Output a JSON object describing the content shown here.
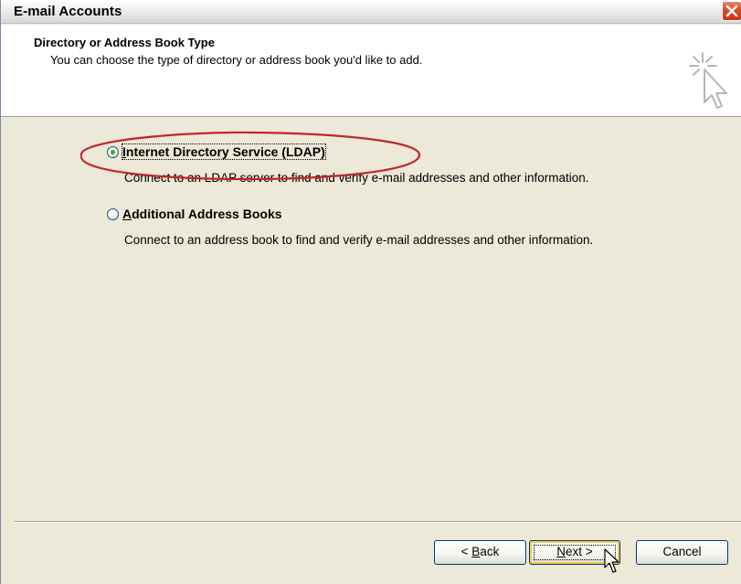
{
  "window": {
    "title": "E-mail Accounts"
  },
  "header": {
    "title": "Directory or Address Book Type",
    "subtitle": "You can choose the type of directory or address book you'd like to add.",
    "icon": "wizard-sparkle-cursor-icon"
  },
  "options": [
    {
      "label_key": "I",
      "label_rest": "nternet Directory Service (LDAP)",
      "description": "Connect to an LDAP server to find and verify e-mail addresses and other information.",
      "selected": true
    },
    {
      "label_key": "A",
      "label_rest": "dditional Address Books",
      "description": "Connect to an address book to find and verify e-mail addresses and other information.",
      "selected": false
    }
  ],
  "buttons": {
    "back_prefix": "< ",
    "back_key": "B",
    "back_rest": "ack",
    "next_key": "N",
    "next_rest": "ext >",
    "cancel": "Cancel"
  },
  "colors": {
    "annotation": "#c0262d",
    "dialog_bg": "#ece9d8",
    "radio_dot": "#3fa13b"
  }
}
